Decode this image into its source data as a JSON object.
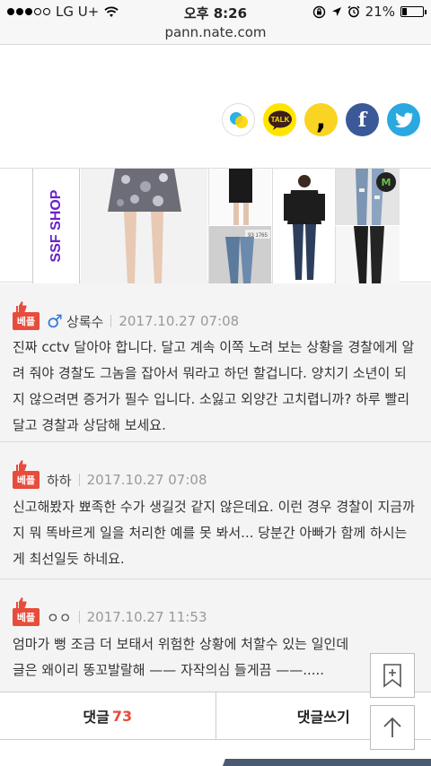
{
  "status_bar": {
    "carrier": "LG U+",
    "time": "오후 8:26",
    "battery": "21%",
    "battery_level": 0.21,
    "url": "pann.nate.com"
  },
  "share": {
    "icons": [
      "kakaostory-icon",
      "kakaotalk-icon",
      "comma-icon",
      "facebook-icon",
      "twitter-icon"
    ],
    "talk_label": "TALK",
    "comma_glyph": ",",
    "fb_glyph": "f"
  },
  "ad": {
    "brand": "SSF SHOP",
    "corner_badge": "M",
    "tag_text": "93 1765"
  },
  "comments": [
    {
      "badge": "베플",
      "gender": "♂",
      "nickname": "상록수",
      "date": "2017.10.27 07:08",
      "body": "진짜 cctv 달아야 합니다. 달고 계속 이쪽 노려 보는 상황을 경찰에게 알려 줘야 경찰도 그놈을 잡아서 뭐라고 하던 할겁니다. 양치기 소년이 되지 않으려면 증거가 필수 입니다. 소잃고 외양간 고치렵니까? 하루 빨리 달고 경찰과 상담해 보세요."
    },
    {
      "badge": "베플",
      "nickname": "하하",
      "date": "2017.10.27 07:08",
      "body": "신고해봤자 뾰족한 수가 생길것 같지 않은데요. 이런 경우 경찰이 지금까지 뭐 똑바르게 일을 처리한 예를 못 봐서... 당분간 아빠가 함께 하시는게 최선일듯 하네요."
    },
    {
      "badge": "베플",
      "nickname": "ㅇㅇ",
      "date": "2017.10.27 11:53",
      "body": "엄마가 뻥 조금 더 보태서 위험한 상황에 처할수 있는 일인데 글은 왜이리 똥꼬발랄해 —— 자작의심 들게끔 ——....."
    }
  ],
  "bottom_bar": {
    "comments_label": "댓글",
    "comments_count": "73",
    "write_label": "댓글쓰기"
  },
  "floating": {
    "bookmark_icon": "bookmark-add-icon",
    "top_icon": "arrow-up-icon"
  },
  "colors": {
    "accent_red": "#e74c3c",
    "ad_brand_purple": "#6a22c7",
    "facebook_blue": "#3b5998",
    "twitter_blue": "#2aa9e0",
    "kakao_yellow": "#fee500"
  }
}
